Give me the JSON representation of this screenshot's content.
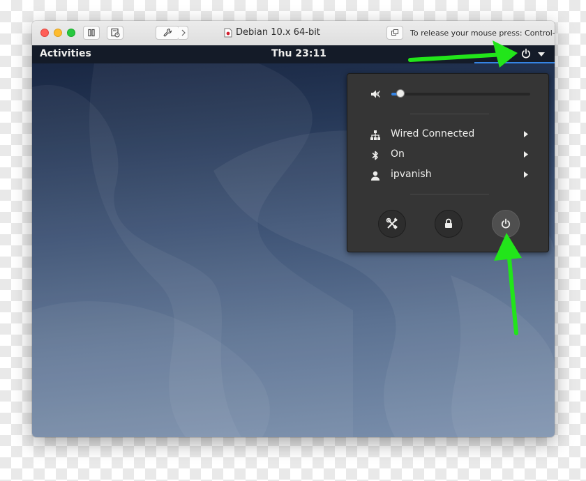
{
  "vm_window": {
    "title": "Debian 10.x 64-bit",
    "release_hint": "To release your mouse press: Control-⌘",
    "buttons": {
      "pause_icon": "pause-icon",
      "snapshot_icon": "snapshot-icon",
      "settings_icon": "wrench-icon",
      "forward_icon": "chevron-right-icon",
      "title_icon": "vm-document-icon",
      "fullscreen_icon": "overlap-windows-icon"
    },
    "traffic_light_colors": {
      "close": "#ff5f57",
      "minimize": "#febc2e",
      "maximize": "#28c840"
    }
  },
  "gnome_topbar": {
    "activities": "Activities",
    "clock": "Thu 23:11",
    "indicators": [
      "power-icon",
      "caret-down-icon"
    ]
  },
  "system_menu": {
    "volume": {
      "icon": "speaker-muted-icon",
      "level": 0.05
    },
    "items": [
      {
        "icon": "network-wired-icon",
        "label": "Wired Connected",
        "has_submenu": true
      },
      {
        "icon": "bluetooth-icon",
        "label": "On",
        "has_submenu": true
      },
      {
        "icon": "user-icon",
        "label": "ipvanish",
        "has_submenu": true
      }
    ],
    "actions": [
      {
        "icon": "settings-tools-icon",
        "active": false
      },
      {
        "icon": "lock-icon",
        "active": false
      },
      {
        "icon": "power-icon",
        "active": true
      }
    ]
  },
  "annotations": {
    "arrow_color": "#22e51a",
    "count": 2
  },
  "colors": {
    "topbar": "#141b28",
    "menu_bg": "#353535",
    "accent": "#3584e4",
    "text": "#eeeeec"
  }
}
